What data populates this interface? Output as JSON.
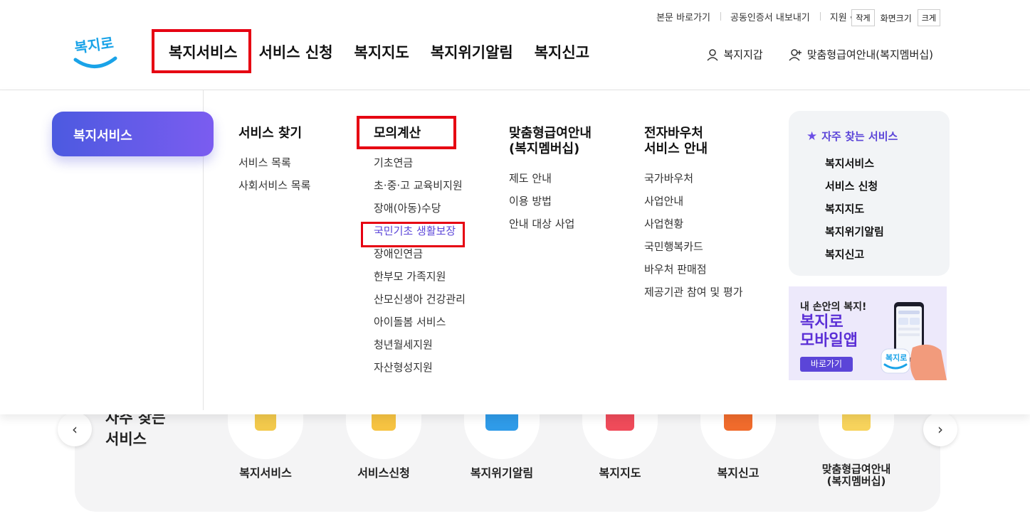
{
  "utility": {
    "skip": "본문 바로가기",
    "cert": "공동인증서 내보내기",
    "support": "지원",
    "small": "작게",
    "zoom": "화면크기",
    "large": "크게"
  },
  "logo": "복지로",
  "gnb": [
    "복지서비스",
    "서비스 신청",
    "복지지갑",
    "복지위기알림",
    "복지신고"
  ],
  "gnb_display": [
    "복지서비스",
    "서비스 신청",
    "복지지도",
    "복지위기알림",
    "복지신고"
  ],
  "header_right": {
    "wallet": "복지지갑",
    "membership": "맞춤형급여안내(복지멤버십)"
  },
  "mega": {
    "side": "복지서비스",
    "columns": [
      {
        "title": "서비스 찾기",
        "links": [
          "서비스 목록",
          "사회서비스 목록"
        ]
      },
      {
        "title": "모의계산",
        "links": [
          "기초연금",
          "초·중·고 교육비지원",
          "장애(아동)수당",
          "국민기초 생활보장",
          "장애인연금",
          "한부모 가족지원",
          "산모신생아 건강관리",
          "아이돌봄 서비스",
          "청년월세지원",
          "자산형성지원"
        ]
      },
      {
        "title": "맞춤형급여안내\n(복지멤버십)",
        "title1": "맞춤형급여안내",
        "title2": "(복지멤버십)",
        "links": [
          "제도 안내",
          "이용 방법",
          "안내 대상 사업"
        ]
      },
      {
        "title1": "전자바우처",
        "title2": "서비스 안내",
        "links": [
          "국가바우처",
          "사업안내",
          "사업현황",
          "국민행복카드",
          "바우처 판매점",
          "제공기관 참여 및 평가"
        ]
      }
    ],
    "favorites": {
      "title": "자주 찾는 서비스",
      "items": [
        "복지서비스",
        "서비스 신청",
        "복지지도",
        "복지위기알림",
        "복지신고"
      ]
    },
    "banner": {
      "sub": "내 손안의 복지!",
      "main1": "복지로",
      "main2": "모바일앱",
      "button": "바로가기"
    }
  },
  "quick": {
    "title1": "자주 찾는",
    "title2": "서비스",
    "items": [
      "복지서비스",
      "서비스신청",
      "복지위기알림",
      "복지지도",
      "복지신고"
    ],
    "last1": "맞춤형급여안내",
    "last2": "(복지멤버십)"
  },
  "colors": {
    "accent": "#5b45d8",
    "highlight": "#e60012"
  }
}
